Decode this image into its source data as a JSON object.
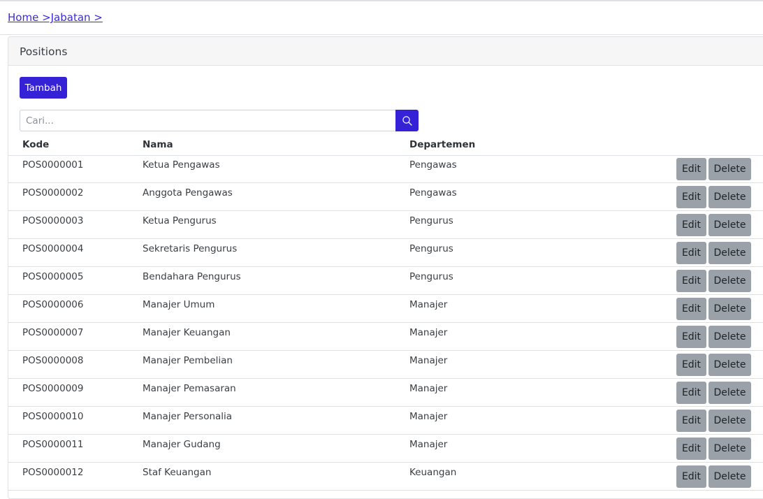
{
  "breadcrumb": {
    "text": "Home >Jabatan >"
  },
  "card": {
    "title": "Positions"
  },
  "toolbar": {
    "add_label": "Tambah"
  },
  "search": {
    "placeholder": "Cari...",
    "value": ""
  },
  "table": {
    "headers": {
      "kode": "Kode",
      "nama": "Nama",
      "departemen": "Departemen"
    },
    "edit_label": "Edit",
    "delete_label": "Delete",
    "rows": [
      {
        "kode": "POS0000001",
        "nama": "Ketua Pengawas",
        "departemen": "Pengawas"
      },
      {
        "kode": "POS0000002",
        "nama": "Anggota Pengawas",
        "departemen": "Pengawas"
      },
      {
        "kode": "POS0000003",
        "nama": "Ketua Pengurus",
        "departemen": "Pengurus"
      },
      {
        "kode": "POS0000004",
        "nama": "Sekretaris Pengurus",
        "departemen": "Pengurus"
      },
      {
        "kode": "POS0000005",
        "nama": "Bendahara Pengurus",
        "departemen": "Pengurus"
      },
      {
        "kode": "POS0000006",
        "nama": "Manajer Umum",
        "departemen": "Manajer"
      },
      {
        "kode": "POS0000007",
        "nama": "Manajer Keuangan",
        "departemen": "Manajer"
      },
      {
        "kode": "POS0000008",
        "nama": "Manajer Pembelian",
        "departemen": "Manajer"
      },
      {
        "kode": "POS0000009",
        "nama": "Manajer Pemasaran",
        "departemen": "Manajer"
      },
      {
        "kode": "POS0000010",
        "nama": "Manajer Personalia",
        "departemen": "Manajer"
      },
      {
        "kode": "POS0000011",
        "nama": "Manajer Gudang",
        "departemen": "Manajer"
      },
      {
        "kode": "POS0000012",
        "nama": "Staf Keuangan",
        "departemen": "Keuangan"
      }
    ]
  },
  "icons": {
    "search": "search-icon"
  },
  "colors": {
    "primary": "#3622d6",
    "secondary_button": "#9aa1a9",
    "link": "#3d2bd6"
  }
}
